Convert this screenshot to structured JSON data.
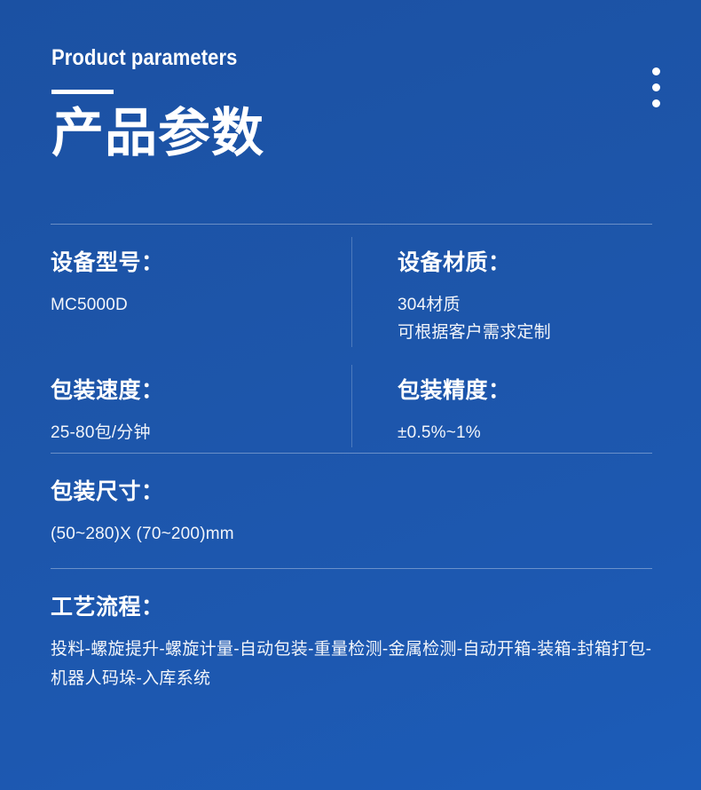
{
  "header": {
    "title_en": "Product parameters",
    "title_cn": "产品参数",
    "menu_icon": "kebab-menu-icon"
  },
  "theme": {
    "background_top": "#1b51a3",
    "background_bottom": "#1c5cb8",
    "text": "#ffffff",
    "divider": "#b9cbe6"
  },
  "specs": {
    "rows": [
      {
        "left": {
          "label": "设备型号：",
          "lines": [
            "MC5000D"
          ]
        },
        "right": {
          "label": "设备材质：",
          "lines": [
            "304材质",
            "可根据客户需求定制"
          ]
        }
      },
      {
        "left": {
          "label": "包装速度：",
          "lines": [
            "25-80包/分钟"
          ]
        },
        "right": {
          "label": "包装精度：",
          "lines": [
            "±0.5%~1%"
          ]
        }
      }
    ],
    "size_block": {
      "label": "包装尺寸：",
      "value": "(50~280)X (70~200)mm"
    },
    "flow_block": {
      "label": "工艺流程：",
      "value": "投料-螺旋提升-螺旋计量-自动包装-重量检测-金属检测-自动开箱-装箱-封箱打包-机器人码垛-入库系统"
    }
  }
}
